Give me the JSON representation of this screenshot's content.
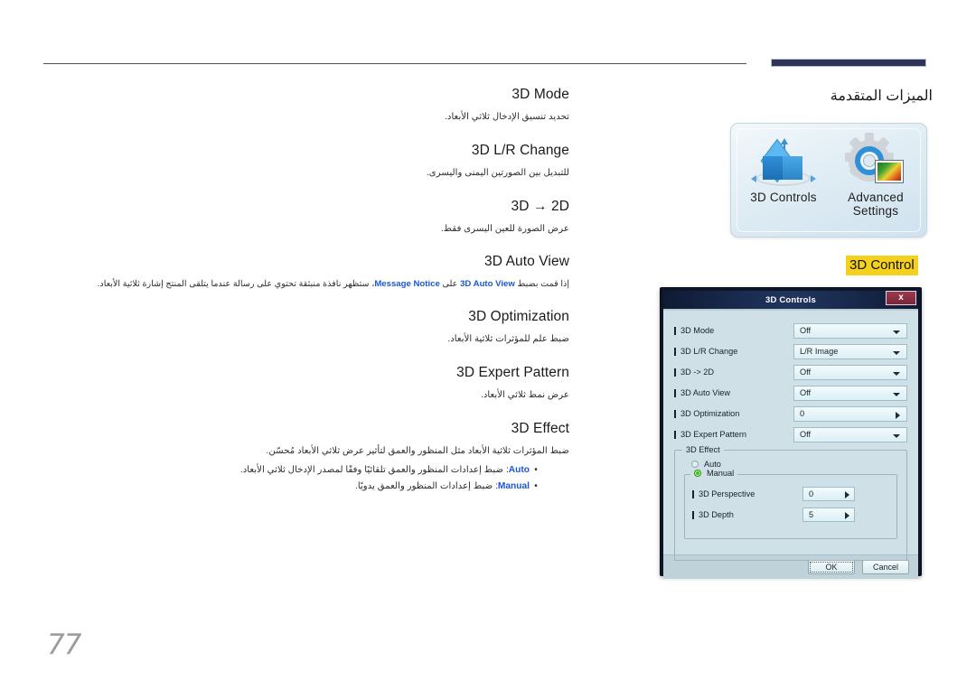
{
  "section": {
    "title": "الميزات المتقدمة",
    "highlight_label": "3D Control",
    "highlight_color": "#f5d11e"
  },
  "icon_panel": {
    "items": [
      {
        "icon": "3d-cube-icon",
        "label": "3D Controls"
      },
      {
        "icon": "gear-with-photo-icon",
        "label": "Advanced\nSettings"
      }
    ],
    "advanced_line1": "Advanced",
    "advanced_line2": "Settings"
  },
  "doc": {
    "blocks": [
      {
        "heading": "3D Mode",
        "desc": "تحديد تنسيق الإدخال ثلاثي الأبعاد."
      },
      {
        "heading": "3D L/R Change",
        "desc": "للتبديل بين الصورتين اليمنى واليسرى."
      },
      {
        "heading": "3D → 2D",
        "desc": "عرض الصورة للعين اليسرى فقط."
      },
      {
        "heading": "3D Auto View",
        "desc_pre": "إذا قمت بضبط ",
        "desc_kw1": "3D Auto View",
        "desc_mid": " على ",
        "desc_kw2": "Message Notice",
        "desc_post": "، ستظهر نافذة منبثقة تحتوي على رسالة عندما يتلقى المنتج إشارة ثلاثية الأبعاد."
      },
      {
        "heading": "3D Optimization",
        "desc": "ضبط علم للمؤثرات ثلاثية الأبعاد."
      },
      {
        "heading": "3D Expert Pattern",
        "desc": "عرض نمط ثلاثي الأبعاد."
      },
      {
        "heading": "3D Effect",
        "desc": "ضبط المؤثرات ثلاثية الأبعاد مثل المنظور والعمق لتأثير عرض ثلاثي الأبعاد مُحسّن."
      }
    ],
    "bullets": [
      {
        "marker": "•",
        "keyword": "Auto",
        "text": ": ضبط إعدادات المنظور والعمق تلقائيًا وفقًا لمصدر الإدخال ثلاثي الأبعاد."
      },
      {
        "marker": "•",
        "keyword": "Manual",
        "text": ": ضبط إعدادات المنظور والعمق يدويًا."
      }
    ]
  },
  "dialog": {
    "title": "3D Controls",
    "close_label": "x",
    "fields": [
      {
        "label": "3D Mode",
        "value": "Off",
        "control": "dropdown"
      },
      {
        "label": "3D L/R Change",
        "value": "L/R Image",
        "control": "dropdown"
      },
      {
        "label": "3D -> 2D",
        "value": "Off",
        "control": "dropdown"
      },
      {
        "label": "3D Auto View",
        "value": "Off",
        "control": "dropdown"
      },
      {
        "label": "3D Optimization",
        "value": "0",
        "control": "stepper"
      },
      {
        "label": "3D Expert Pattern",
        "value": "Off",
        "control": "dropdown"
      }
    ],
    "effect_group": {
      "legend": "3D Effect",
      "auto_label": "Auto",
      "auto_selected": false,
      "manual_label": "Manual",
      "manual_selected": true,
      "sub_fields": [
        {
          "label": "3D Perspective",
          "value": "0"
        },
        {
          "label": "3D Depth",
          "value": "5"
        }
      ]
    },
    "buttons": {
      "ok": "OK",
      "cancel": "Cancel"
    }
  },
  "footer": {
    "page_number": "77"
  }
}
